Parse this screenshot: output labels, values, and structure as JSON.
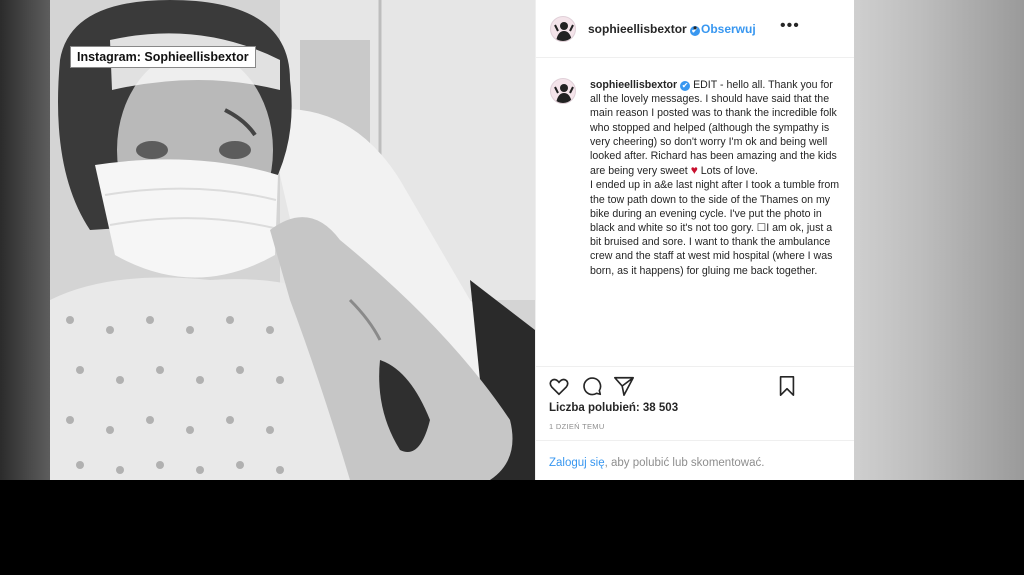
{
  "watermark": "Instagram: Sophieellisbextor",
  "post": {
    "username": "sophieellisbextor",
    "verified_glyph": "✔",
    "separator": "•",
    "follow_label": "Obserwuj",
    "more_glyph": "•••",
    "caption_text": "EDIT - hello all. Thank you for all the lovely messages. I should have said that the main reason I posted was to thank the incredible folk who stopped and helped (although the sympathy is very cheering) so don't worry I'm ok and being well looked after. Richard has been amazing and the kids are being very sweet",
    "heart_glyph": "♥",
    "caption_text_2": "Lots of love.",
    "caption_text_3": "I ended up in a&e last night after I took a tumble from the tow path down to the side of the Thames on my bike during an evening cycle. I've put the photo in black and white so it's not too gory. ☐I am ok, just a bit bruised and sore. I want to thank the ambulance crew and the staff at west mid hospital (where I was born, as it happens) for gluing me back together.",
    "likes": "Liczba polubień: 38 503",
    "time_ago": "1 DZIEŃ TEMU",
    "login_link": "Zaloguj się",
    "login_rest": ", aby polubić lub skomentować."
  },
  "icons": [
    "heart-icon",
    "comment-icon",
    "share-icon",
    "bookmark-icon",
    "verified-icon",
    "more-icon"
  ],
  "colors": {
    "link": "#3897f0",
    "text": "#262626",
    "muted": "#8e8e8e",
    "heart": "#c8102e"
  }
}
